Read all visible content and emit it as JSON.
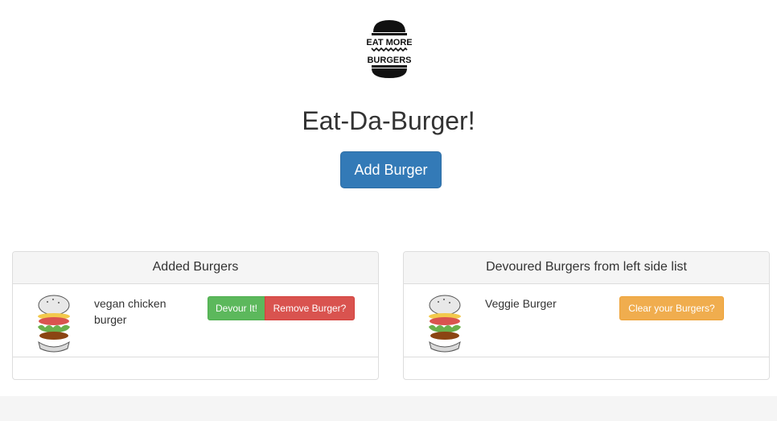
{
  "header": {
    "logo_text_line1": "EAT MORE",
    "logo_text_line2": "BURGERS",
    "title": "Eat-Da-Burger!",
    "add_button_label": "Add Burger"
  },
  "added_panel": {
    "heading": "Added Burgers",
    "items": [
      {
        "name": "vegan chicken burger",
        "devour_label": "Devour It!",
        "remove_label": "Remove Burger?"
      }
    ]
  },
  "devoured_panel": {
    "heading": "Devoured Burgers from left side list",
    "items": [
      {
        "name": "Veggie Burger",
        "clear_label": "Clear your Burgers?"
      }
    ]
  },
  "colors": {
    "primary": "#337ab7",
    "success": "#5cb85c",
    "danger": "#d9534f",
    "warning": "#f0ad4e"
  }
}
